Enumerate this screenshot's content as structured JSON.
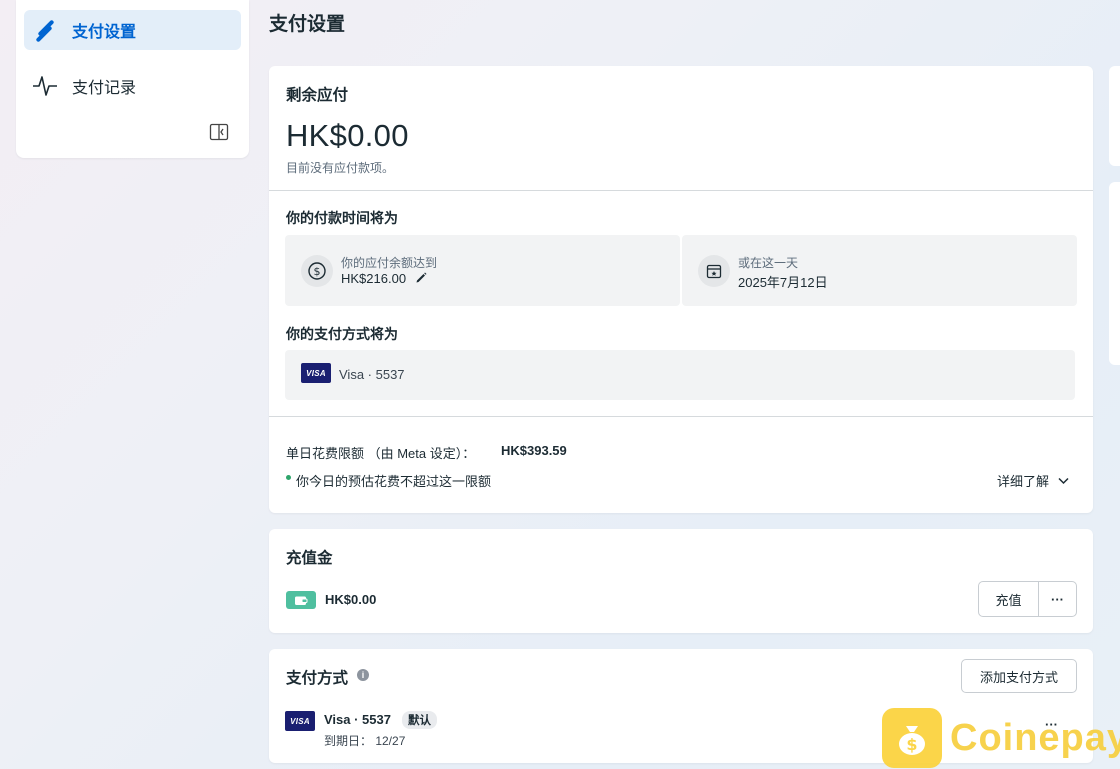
{
  "sidebar": {
    "items": [
      {
        "label": "支付设置",
        "icon": "pencil-lines-icon"
      },
      {
        "label": "支付记录",
        "icon": "activity-pulse-icon"
      }
    ],
    "collapse_icon": "sidebar-collapse-icon"
  },
  "page": {
    "title": "支付设置"
  },
  "balance": {
    "heading": "剩余应付",
    "amount": "HK$0.00",
    "note": "目前没有应付款项。"
  },
  "schedule": {
    "heading": "你的付款时间将为",
    "threshold_label": "你的应付余额达到",
    "threshold_value": "HK$216.00",
    "date_label": "或在这一天",
    "date_value": "2025年7月12日"
  },
  "payment_method_preview": {
    "heading": "你的支付方式将为",
    "card_brand": "VISA",
    "card_text": "Visa · 5537"
  },
  "daily_limit": {
    "label": "单日花费限额 （由 Meta 设定）：",
    "value": "HK$393.59",
    "status": "你今日的预估花费不超过这一限额",
    "learn_more": "详细了解"
  },
  "prepaid": {
    "heading": "充值金",
    "amount": "HK$0.00",
    "topup_button": "充值",
    "more_button": "···"
  },
  "payment_methods": {
    "heading": "支付方式",
    "add_button": "添加支付方式",
    "card_brand": "VISA",
    "card_name": "Visa · 5537",
    "default_badge": "默认",
    "expiry": "到期日：  12/27",
    "more_button": "···"
  },
  "watermark": {
    "brand": "Coinepay"
  },
  "colors": {
    "accent": "#0064d1",
    "status_green": "#2ea56b",
    "wallet": "#4fbf9f",
    "visa": "#1a1f71",
    "watermark": "#fbd23a"
  }
}
